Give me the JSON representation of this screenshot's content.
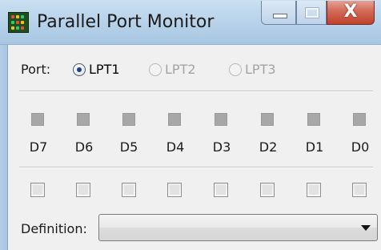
{
  "window": {
    "title": "Parallel Port Monitor",
    "close_glyph": "X"
  },
  "port": {
    "label": "Port:",
    "options": [
      {
        "label": "LPT1",
        "checked": true,
        "enabled": true
      },
      {
        "label": "LPT2",
        "checked": false,
        "enabled": false
      },
      {
        "label": "LPT3",
        "checked": false,
        "enabled": false
      }
    ]
  },
  "data_bits": {
    "labels": [
      "D7",
      "D6",
      "D5",
      "D4",
      "D3",
      "D2",
      "D1",
      "D0"
    ],
    "led_states": [
      false,
      false,
      false,
      false,
      false,
      false,
      false,
      false
    ],
    "checkbox_states": [
      false,
      false,
      false,
      false,
      false,
      false,
      false,
      false
    ]
  },
  "definition": {
    "label": "Definition:",
    "selected": ""
  },
  "colors": {
    "titlebar": "#b9d3ea",
    "close_button": "#c1412b",
    "led_off": "#a7a7a7",
    "radio_dot": "#1d3f8f"
  }
}
